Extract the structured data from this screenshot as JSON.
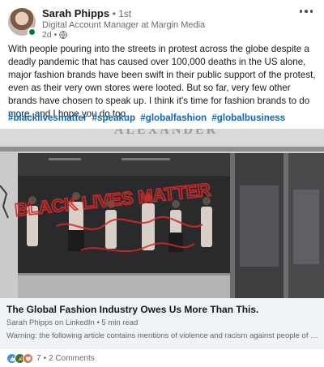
{
  "author": {
    "name": "Sarah Phipps",
    "degree": "• 1st",
    "headline": "Digital Account Manager at Margin Media",
    "time": "2d •"
  },
  "post": {
    "body": "With people pouring into the streets in protest across the globe despite a deadly pandemic that has caused over 100,000 deaths in the US alone, major fashion brands have been swift in their public support of the protest, even as their very own stores were looted. But so far, very few other brands have chosen to speak up. I think it's time for fashion brands to do more, and I hope you do too.",
    "hashtags": [
      "#blacklivesmatter",
      "#speakup",
      "#globalfashion",
      "#globalbusiness"
    ]
  },
  "image": {
    "graffiti_text": "BLACK LIVES MATTER",
    "storefront_sign": "ALEXANDER"
  },
  "article": {
    "title": "The Global Fashion Industry Owes Us More Than This.",
    "meta": "Sarah Phipps on LinkedIn • 5 min read",
    "description": "Warning: the following article contains mentions of violence and racism against people of colour...."
  },
  "social": {
    "reactions": [
      "like-icon",
      "celebrate-icon",
      "love-icon"
    ],
    "reaction_count": "7",
    "separator": "•",
    "comments": "2 Comments"
  },
  "colors": {
    "link_blue": "#0a66c2",
    "online_green": "#057642",
    "card_bg": "#eef3f8",
    "like_blue": "#378fe9",
    "celebrate_green": "#44712e",
    "love_red": "#df704d"
  }
}
